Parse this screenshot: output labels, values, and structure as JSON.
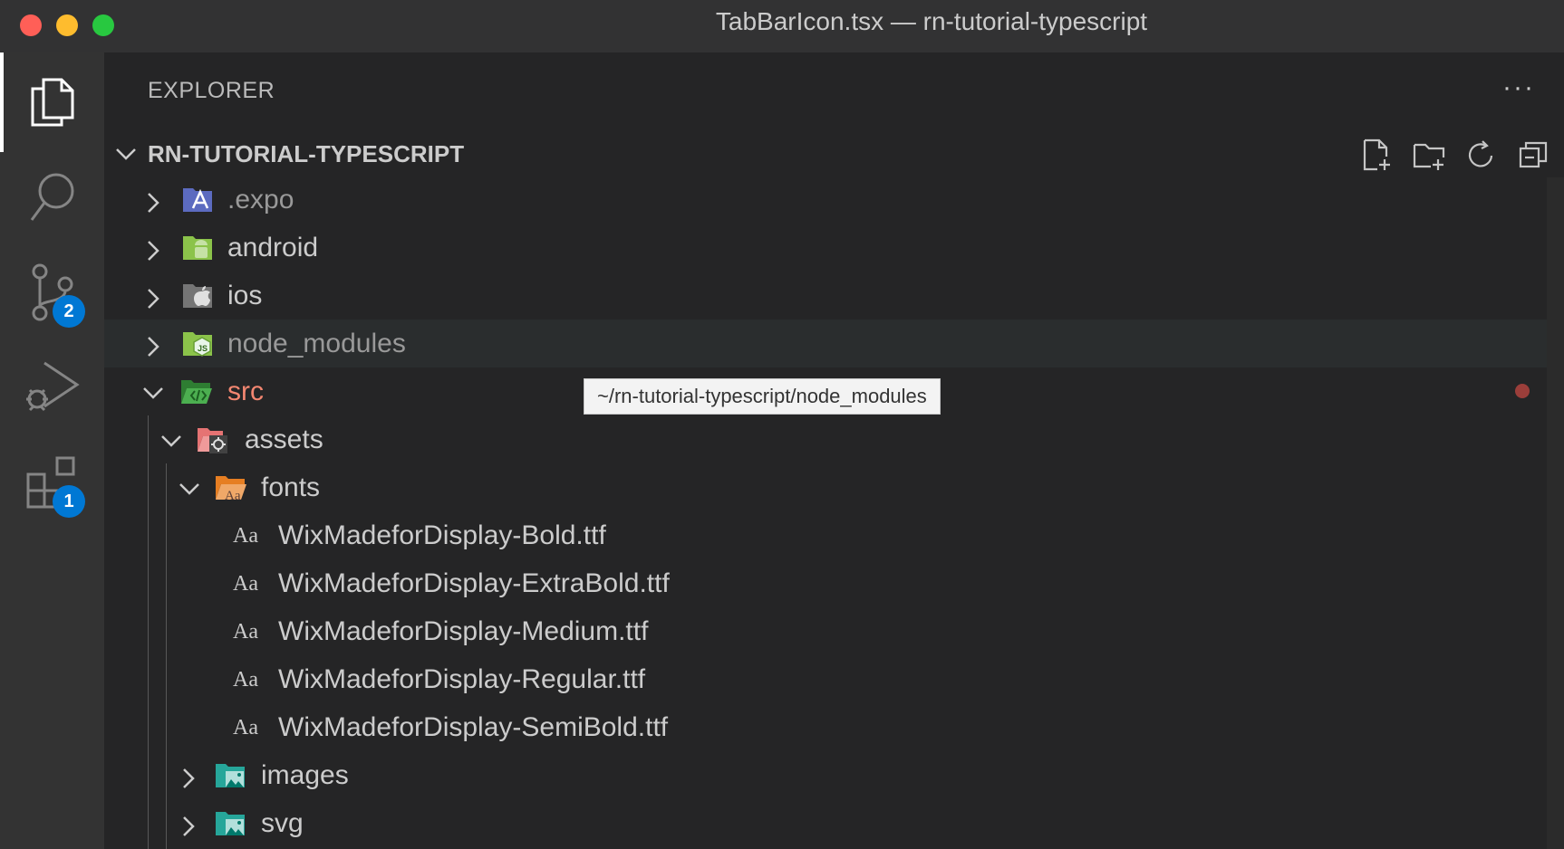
{
  "window": {
    "title": "TabBarIcon.tsx — rn-tutorial-typescript"
  },
  "activity_bar": {
    "items": [
      {
        "name": "Explorer",
        "icon": "files-icon",
        "active": true
      },
      {
        "name": "Search",
        "icon": "search-icon"
      },
      {
        "name": "Source Control",
        "icon": "source-control-icon",
        "badge": "2"
      },
      {
        "name": "Run and Debug",
        "icon": "run-debug-icon"
      },
      {
        "name": "Extensions",
        "icon": "extensions-icon",
        "badge": "1"
      }
    ]
  },
  "explorer": {
    "title": "EXPLORER",
    "more": "···",
    "root": "RN-TUTORIAL-TYPESCRIPT",
    "tree": [
      {
        "label": ".expo",
        "icon": "expo-folder-icon",
        "expanded": false,
        "color": "#999999"
      },
      {
        "label": "android",
        "icon": "android-folder-icon",
        "expanded": false,
        "color": "#cccccc"
      },
      {
        "label": "ios",
        "icon": "ios-folder-icon",
        "expanded": false,
        "color": "#cccccc"
      },
      {
        "label": "node_modules",
        "icon": "node-folder-icon",
        "expanded": false,
        "color": "#999999"
      },
      {
        "label": "src",
        "icon": "src-folder-icon",
        "expanded": true,
        "color": "#f48771"
      },
      {
        "label": "assets",
        "icon": "assets-folder-icon",
        "expanded": true,
        "color": "#cccccc"
      },
      {
        "label": "fonts",
        "icon": "fonts-folder-icon",
        "expanded": true,
        "color": "#cccccc"
      },
      {
        "label": "WixMadeforDisplay-Bold.ttf",
        "icon": "font-file-icon",
        "color": "#cccccc"
      },
      {
        "label": "WixMadeforDisplay-ExtraBold.ttf",
        "icon": "font-file-icon",
        "color": "#cccccc"
      },
      {
        "label": "WixMadeforDisplay-Medium.ttf",
        "icon": "font-file-icon",
        "color": "#cccccc"
      },
      {
        "label": "WixMadeforDisplay-Regular.ttf",
        "icon": "font-file-icon",
        "color": "#cccccc"
      },
      {
        "label": "WixMadeforDisplay-SemiBold.ttf",
        "icon": "font-file-icon",
        "color": "#cccccc"
      },
      {
        "label": "images",
        "icon": "images-folder-icon",
        "expanded": false,
        "color": "#cccccc"
      },
      {
        "label": "svg",
        "icon": "svg-folder-icon",
        "expanded": false,
        "color": "#cccccc"
      }
    ],
    "tooltip": "~/rn-tutorial-typescript/node_modules",
    "font_glyph": "Aa"
  },
  "colors": {
    "accent": "#0078d4",
    "modified_dot": "#9b3e3a",
    "src_label": "#f48771"
  }
}
